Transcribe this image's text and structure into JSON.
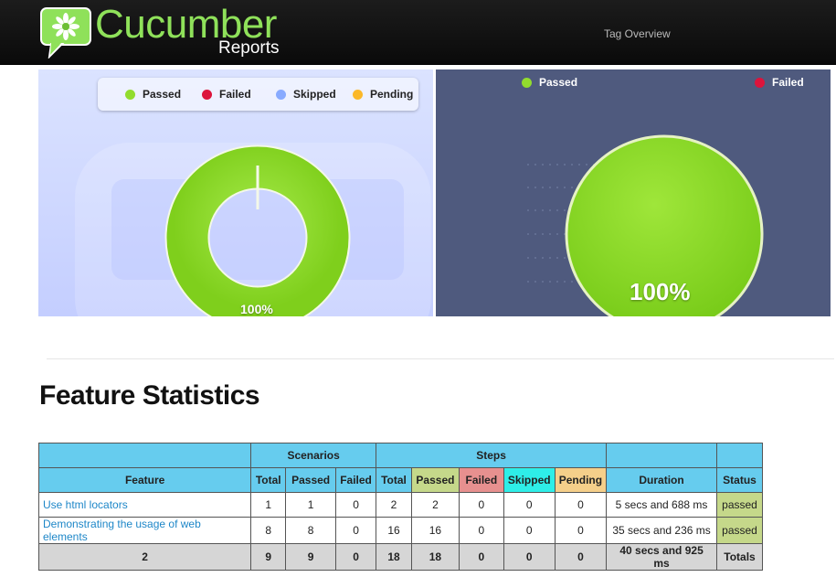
{
  "header": {
    "brand_title": "Cucumber",
    "brand_subtitle": "Reports",
    "nav_tag_overview": "Tag Overview"
  },
  "charts": {
    "steps": {
      "legend": [
        "Passed",
        "Failed",
        "Skipped",
        "Pending"
      ],
      "center_label": "100%",
      "colors": {
        "Passed": "#92dc2e",
        "Failed": "#dc143c",
        "Skipped": "#88aaff",
        "Pending": "#fbb829"
      }
    },
    "scenarios": {
      "legend": [
        "Passed",
        "Failed"
      ],
      "center_label": "100%",
      "colors": {
        "Passed": "#92dc2e",
        "Failed": "#dc143c"
      }
    }
  },
  "chart_data": [
    {
      "type": "pie",
      "categories": [
        "Passed",
        "Failed",
        "Skipped",
        "Pending"
      ],
      "values": [
        18,
        0,
        0,
        0
      ]
    },
    {
      "type": "pie",
      "categories": [
        "Passed",
        "Failed"
      ],
      "values": [
        9,
        0
      ]
    }
  ],
  "feature_statistics": {
    "title": "Feature Statistics",
    "header_groups": {
      "scenarios": "Scenarios",
      "steps": "Steps"
    },
    "columns": {
      "feature": "Feature",
      "scen_total": "Total",
      "scen_passed": "Passed",
      "scen_failed": "Failed",
      "steps_total": "Total",
      "steps_passed": "Passed",
      "steps_failed": "Failed",
      "steps_skipped": "Skipped",
      "steps_pending": "Pending",
      "duration": "Duration",
      "status": "Status"
    },
    "rows": [
      {
        "feature": "Use html locators",
        "scen_total": "1",
        "scen_passed": "1",
        "scen_failed": "0",
        "steps_total": "2",
        "steps_passed": "2",
        "steps_failed": "0",
        "steps_skipped": "0",
        "steps_pending": "0",
        "duration": "5 secs and 688 ms",
        "status": "passed"
      },
      {
        "feature": "Demonstrating the usage of web elements",
        "scen_total": "8",
        "scen_passed": "8",
        "scen_failed": "0",
        "steps_total": "16",
        "steps_passed": "16",
        "steps_failed": "0",
        "steps_skipped": "0",
        "steps_pending": "0",
        "duration": "35 secs and 236 ms",
        "status": "passed"
      }
    ],
    "totals": {
      "feature": "2",
      "scen_total": "9",
      "scen_passed": "9",
      "scen_failed": "0",
      "steps_total": "18",
      "steps_passed": "18",
      "steps_failed": "0",
      "steps_skipped": "0",
      "steps_pending": "0",
      "duration": "40 secs and 925 ms",
      "status": "Totals"
    }
  }
}
